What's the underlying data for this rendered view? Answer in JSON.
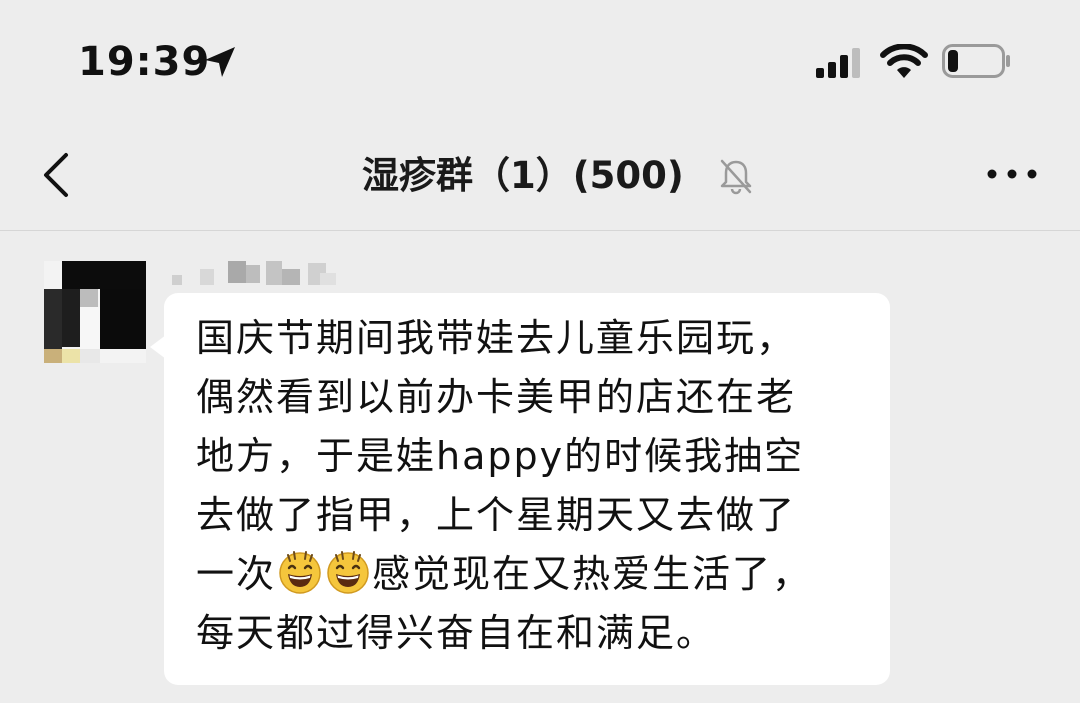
{
  "status_bar": {
    "time": "19:39",
    "icons": [
      "location-arrow-icon",
      "signal-icon",
      "wifi-icon",
      "battery-icon"
    ],
    "battery_level": 0.2
  },
  "nav": {
    "back_icon": "chevron-left-icon",
    "title": "湿疹群（1）(500)",
    "mute_icon": "bell-off-icon",
    "more_icon": "more-dots-icon"
  },
  "message": {
    "sender_name_pixelated": true,
    "avatar_pixelated": true,
    "line1": "国庆节期间我带娃去儿童乐园玩，",
    "line2": "偶然看到以前办卡美甲的店还在老",
    "line3": "地方，于是娃happy的时候我抽空",
    "line4": "去做了指甲，上个星期天又去做了",
    "line5_prefix": "一次",
    "line5_emoji": "grinning-face-emoji",
    "line5_suffix": "感觉现在又热爱生活了，",
    "line6": "每天都过得兴奋自在和满足。"
  },
  "colors": {
    "background": "#ededed",
    "bubble": "#ffffff",
    "text": "#111111",
    "emoji_face": "#f5c63c"
  }
}
